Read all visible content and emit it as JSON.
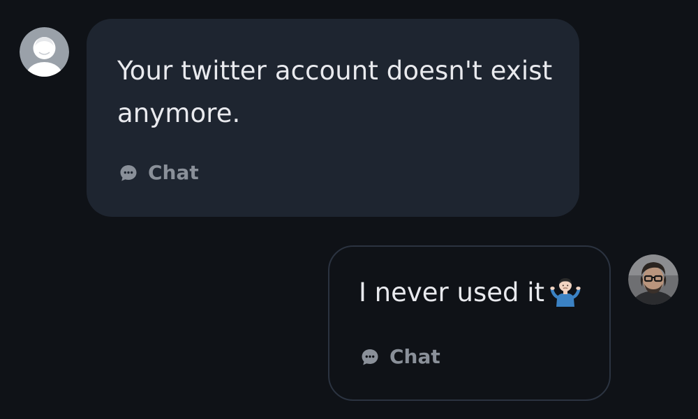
{
  "messages": [
    {
      "direction": "incoming",
      "text": "Your twitter account doesn't exist anymore.",
      "action_label": "Chat",
      "avatar_icon": "default-user-avatar"
    },
    {
      "direction": "outgoing",
      "text": "I never used it",
      "emoji": "🤷🏻‍♂️",
      "action_label": "Chat",
      "avatar_icon": "user-photo-avatar"
    }
  ],
  "colors": {
    "background": "#0f1217",
    "incoming_bubble": "#1e2530",
    "outgoing_border": "#2b3340",
    "text": "#e9eaee",
    "muted": "#8a9099"
  }
}
